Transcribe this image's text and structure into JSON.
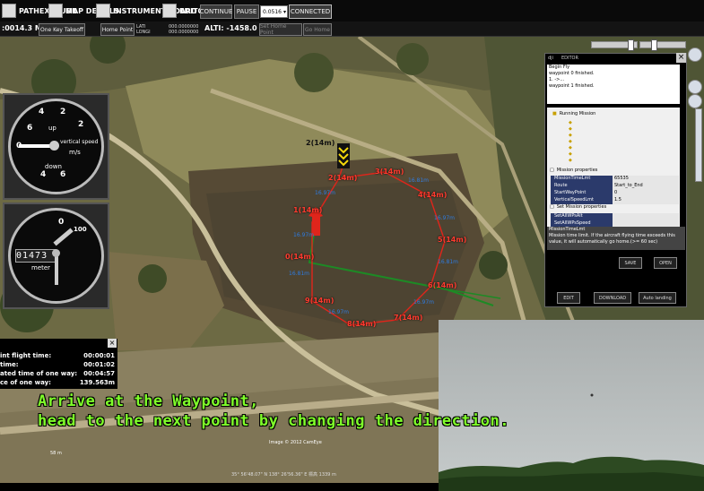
{
  "toolbar": {
    "pathextrude_label": "PATHEXTRUDE",
    "map_details_label": "MAP DETAILS",
    "instrument_board_label": "INSTRUMENT BOARD",
    "editor_label": "EDITOR",
    "continue_label": "CONTINUE",
    "pause_label": "PAUSE",
    "speed_value": "0.0516",
    "connected_label": "CONNECTED"
  },
  "status": {
    "distance": ":0014.3 M",
    "one_key_takeoff": "One Key Takeoff",
    "home_point": "Home Point",
    "lati_label": "LATI",
    "longi_label": "LONGI",
    "lati_value": "000.0000000",
    "longi_value": "000.0000000",
    "alti": "ALTI: -1458.0 M",
    "set_home_point": "Set Home Point",
    "go_home": "Go Home"
  },
  "vertical_speed_gauge": {
    "label": "vertical speed",
    "unit": "m/s",
    "up": "up",
    "down": "down",
    "numbers": [
      "6",
      "4",
      "2",
      "0",
      "2",
      "4",
      "6"
    ]
  },
  "altimeter_gauge": {
    "readout": "01473",
    "unit": "meter",
    "hundred": "100"
  },
  "waypoints": [
    {
      "label": "1(14m)"
    },
    {
      "label": "2(14m)"
    },
    {
      "label": "3(14m)"
    },
    {
      "label": "4(14m)"
    },
    {
      "label": "5(14m)"
    },
    {
      "label": "6(14m)"
    },
    {
      "label": "7(14m)"
    },
    {
      "label": "8(14m)"
    },
    {
      "label": "9(14m)"
    },
    {
      "label": "0(14m)"
    },
    {
      "label": "2(14m)"
    }
  ],
  "segments": [
    "16.97m",
    "16.81m",
    "16.97m",
    "16.81m",
    "16.97m",
    "16.97m",
    "16.81m",
    "16.97m",
    "16.81m"
  ],
  "editor": {
    "title": "EDITOR",
    "log": [
      "Begin Fly",
      "waypoint 0 finished.",
      "1. ->...",
      "waypoint 1 finished."
    ],
    "tree_title": "Running Mission",
    "mission_properties": "Mission properties",
    "props": [
      {
        "k": "MissionTimeLmt",
        "v": "65535"
      },
      {
        "k": "Route",
        "v": "Start_to_End"
      },
      {
        "k": "StartWayPoint",
        "v": "0"
      },
      {
        "k": "VerticalSpeedLmt",
        "v": "1.5"
      }
    ],
    "set_mission_properties": "Set Mission properties",
    "set_props": [
      {
        "k": "SetAllWPsAlt",
        "v": ""
      },
      {
        "k": "SetAllWPsSpeed",
        "v": ""
      }
    ],
    "desc_title": "MissionTimeLmt",
    "desc_text": "Mission time limit. If the aircraft flying time exceeds this value, it will automatically go home.(>= 60 sec)",
    "save": "SAVE",
    "open": "OPEN",
    "edit": "EDIT",
    "download": "DOWNLOAD",
    "auto_landing": "Auto landing"
  },
  "stats": [
    {
      "label": "int flight time:",
      "value": "00:00:01"
    },
    {
      "label": "time:",
      "value": "00:01:02"
    },
    {
      "label": "ated time of one way:",
      "value": "00:04:57"
    },
    {
      "label": "ce of one way:",
      "value": "139.563m"
    }
  ],
  "caption": {
    "line1": "Arrive at the Waypoint,",
    "line2": "head to the next point by changing the direction."
  },
  "map_footer": {
    "copyright": "Image © 2012 CamEye",
    "coords": "35° 56'48.07\" N 138° 26'56.36\" E 標高 1339 m",
    "scale": "58 m"
  },
  "colors": {
    "route": "#e0251b",
    "track": "#1d8a25",
    "caption": "#7fff2a",
    "segment": "#2e7be0"
  }
}
